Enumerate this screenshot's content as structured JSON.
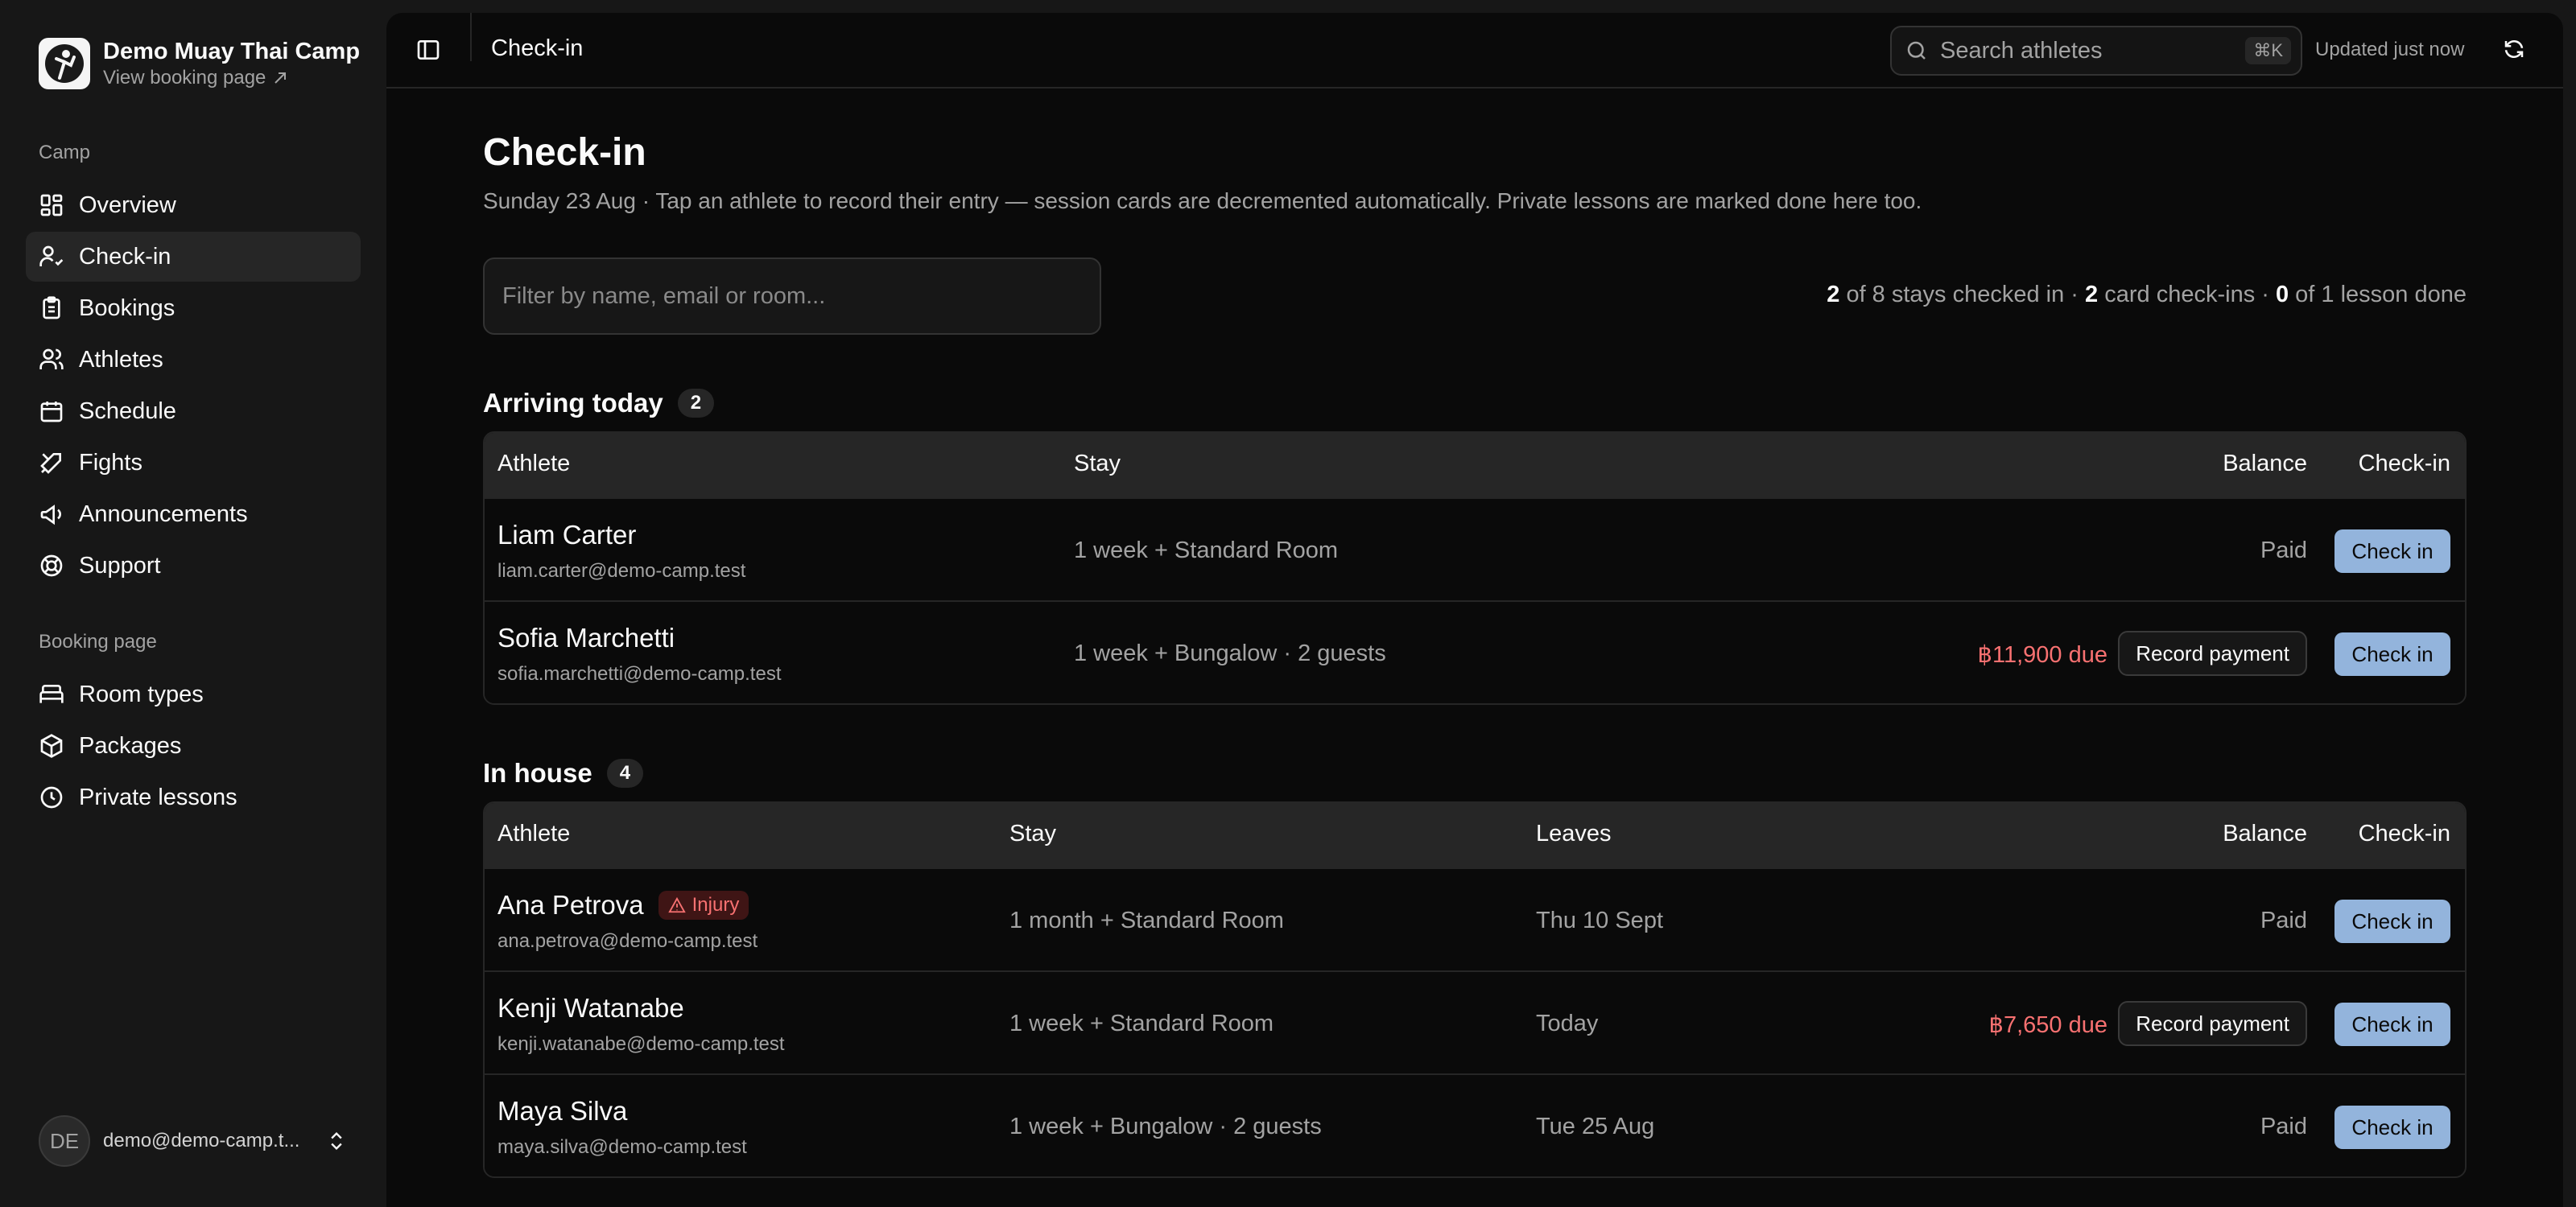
{
  "brand": {
    "name": "Demo Muay Thai Camp",
    "link": "View booking page"
  },
  "sidebar": {
    "group_camp": "Camp",
    "camp_items": [
      {
        "label": "Overview",
        "icon": "grid-icon"
      },
      {
        "label": "Check-in",
        "icon": "user-check-icon"
      },
      {
        "label": "Bookings",
        "icon": "clipboard-icon"
      },
      {
        "label": "Athletes",
        "icon": "users-icon"
      },
      {
        "label": "Schedule",
        "icon": "calendar-icon"
      },
      {
        "label": "Fights",
        "icon": "swords-icon"
      },
      {
        "label": "Announcements",
        "icon": "megaphone-icon"
      },
      {
        "label": "Support",
        "icon": "lifebuoy-icon"
      }
    ],
    "group_booking": "Booking page",
    "booking_items": [
      {
        "label": "Room types",
        "icon": "bed-icon"
      },
      {
        "label": "Packages",
        "icon": "package-icon"
      },
      {
        "label": "Private lessons",
        "icon": "clock-icon"
      }
    ],
    "user": {
      "initials": "DE",
      "email": "demo@demo-camp.t..."
    }
  },
  "topbar": {
    "title": "Check-in",
    "search_placeholder": "Search athletes",
    "shortcut": "⌘K",
    "updated": "Updated just now"
  },
  "page": {
    "title": "Check-in",
    "subtitle": "Sunday 23 Aug · Tap an athlete to record their entry — session cards are decremented automatically. Private lessons are marked done here too.",
    "filter_placeholder": "Filter by name, email or room...",
    "stats": {
      "stays_checked": "2",
      "stays_total_text": "of 8 stays checked in ·",
      "card_checkins": "2",
      "card_text": "card check-ins ·",
      "lessons_done": "0",
      "lessons_text": "of 1 lesson done"
    }
  },
  "arriving": {
    "title": "Arriving today",
    "count": "2",
    "headers": {
      "athlete": "Athlete",
      "stay": "Stay",
      "balance": "Balance",
      "checkin": "Check-in"
    },
    "rows": [
      {
        "name": "Liam Carter",
        "email": "liam.carter@demo-camp.test",
        "stay": "1 week + Standard Room",
        "balance": "Paid",
        "action": "Check in"
      },
      {
        "name": "Sofia Marchetti",
        "email": "sofia.marchetti@demo-camp.test",
        "stay": "1 week + Bungalow · 2 guests",
        "due": "฿11,900 due",
        "record": "Record payment",
        "action": "Check in"
      }
    ]
  },
  "inhouse": {
    "title": "In house",
    "count": "4",
    "headers": {
      "athlete": "Athlete",
      "stay": "Stay",
      "leaves": "Leaves",
      "balance": "Balance",
      "checkin": "Check-in"
    },
    "rows": [
      {
        "name": "Ana Petrova",
        "badge": "Injury",
        "email": "ana.petrova@demo-camp.test",
        "stay": "1 month + Standard Room",
        "leaves": "Thu 10 Sept",
        "balance": "Paid",
        "action": "Check in"
      },
      {
        "name": "Kenji Watanabe",
        "email": "kenji.watanabe@demo-camp.test",
        "stay": "1 week + Standard Room",
        "leaves": "Today",
        "due": "฿7,650 due",
        "record": "Record payment",
        "action": "Check in"
      },
      {
        "name": "Maya Silva",
        "email": "maya.silva@demo-camp.test",
        "stay": "1 week + Bungalow · 2 guests",
        "leaves": "Tue 25 Aug",
        "balance": "Paid",
        "action": "Check in"
      }
    ]
  }
}
